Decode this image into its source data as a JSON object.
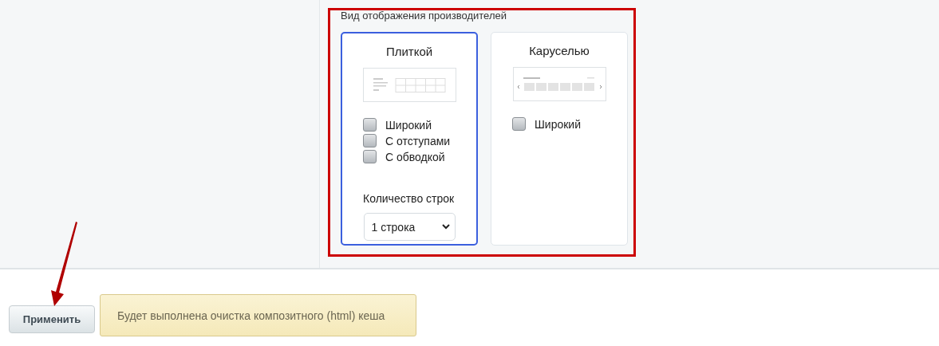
{
  "section": {
    "title": "Вид отображения производителей",
    "options": [
      {
        "kind": "tile",
        "title": "Плиткой",
        "selected": true,
        "checkboxes": [
          {
            "label": "Широкий",
            "checked": false
          },
          {
            "label": "С отступами",
            "checked": false
          },
          {
            "label": "С обводкой",
            "checked": false
          }
        ],
        "rows_label": "Количество строк",
        "rows_select": "1 строка"
      },
      {
        "kind": "carousel",
        "title": "Каруселью",
        "selected": false,
        "checkboxes": [
          {
            "label": "Широкий",
            "checked": false
          }
        ]
      }
    ]
  },
  "footer": {
    "apply_button": "Применить",
    "note": "Будет выполнена очистка композитного (html) кеша"
  }
}
